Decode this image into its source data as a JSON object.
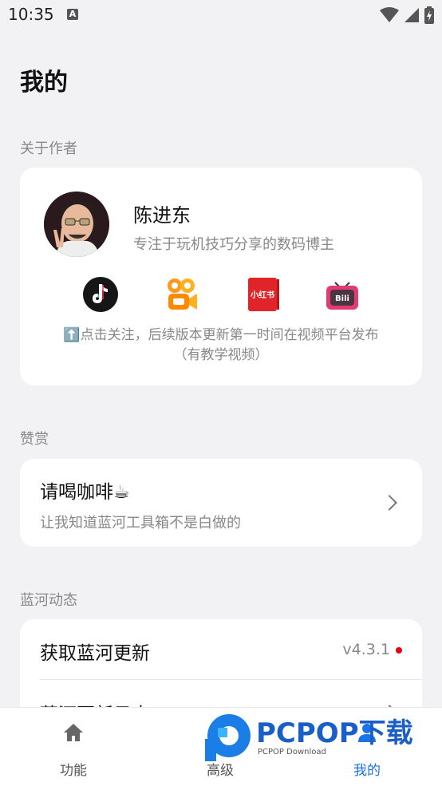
{
  "status_bar": {
    "time": "10:35",
    "notification_badge": "A"
  },
  "page_title": "我的",
  "about": {
    "section_label": "关于作者",
    "author_name": "陈进东",
    "author_desc": "专注于玩机技巧分享的数码博主",
    "platforms": [
      {
        "icon": "douyin-icon"
      },
      {
        "icon": "kuaishou-icon"
      },
      {
        "icon": "xiaohongshu-icon",
        "text": "小红书"
      },
      {
        "icon": "bilibili-icon"
      }
    ],
    "follow_hint_line1": "⬆️点击关注，后续版本更新第一时间在视频平台发布",
    "follow_hint_line2": "（有教学视频）"
  },
  "tip": {
    "section_label": "赞赏",
    "title": "请喝咖啡☕",
    "subtitle": "让我知道蓝河工具箱不是白做的"
  },
  "updates": {
    "section_label": "蓝河动态",
    "get_update_label": "获取蓝河更新",
    "version": "v4.3.1",
    "changelog_label": "蓝河更新日志"
  },
  "bottom_nav": [
    {
      "label": "功能",
      "icon": "home-icon",
      "active": false
    },
    {
      "label": "高级",
      "icon": "advanced-icon",
      "active": false
    },
    {
      "label": "我的",
      "icon": "profile-icon",
      "active": true
    }
  ],
  "watermark": {
    "brand": "PCPOP下载",
    "sub": "PCPOP Download"
  },
  "colors": {
    "accent": "#1a73e8",
    "background": "#f2f2f5",
    "badge_red": "#e60012"
  }
}
